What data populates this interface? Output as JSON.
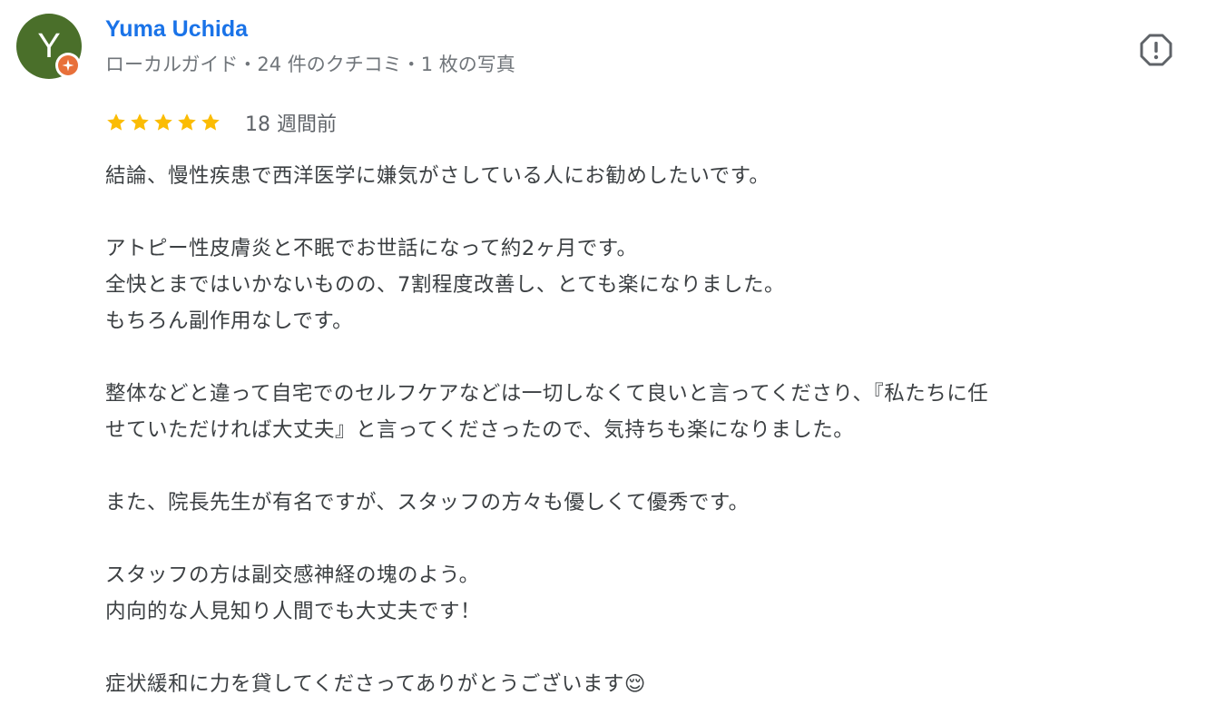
{
  "reviewer": {
    "avatar_initial": "Y",
    "name": "Yuma Uchida",
    "meta": "ローカルガイド・24 件のクチコミ・1 枚の写真",
    "badge_icon": "local-guide-star-icon"
  },
  "review": {
    "rating": 5,
    "time": "18 週間前",
    "paragraphs": [
      [
        "結論、慢性疾患で西洋医学に嫌気がさしている人にお勧めしたいです。"
      ],
      [
        "アトピー性皮膚炎と不眠でお世話になって約2ヶ月です。",
        "全快とまではいかないものの、7割程度改善し、とても楽になりました。",
        "もちろん副作用なしです。"
      ],
      [
        "整体などと違って自宅でのセルフケアなどは一切しなくて良いと言ってくださり、『私たちに任",
        "せていただければ大丈夫』と言ってくださったので、気持ちも楽になりました。"
      ],
      [
        "また、院長先生が有名ですが、スタッフの方々も優しくて優秀です。"
      ],
      [
        "スタッフの方は副交感神経の塊のよう。",
        "内向的な人見知り人間でも大丈夫です！"
      ],
      [
        "症状緩和に力を貸してくださってありがとうございます😌"
      ]
    ]
  },
  "colors": {
    "avatar_bg": "#4a6f2a",
    "name": "#1a73e8",
    "star": "#fbbc04",
    "badge": "#e8703a"
  },
  "icons": {
    "flag": "report-flag-icon",
    "star": "star-icon"
  }
}
